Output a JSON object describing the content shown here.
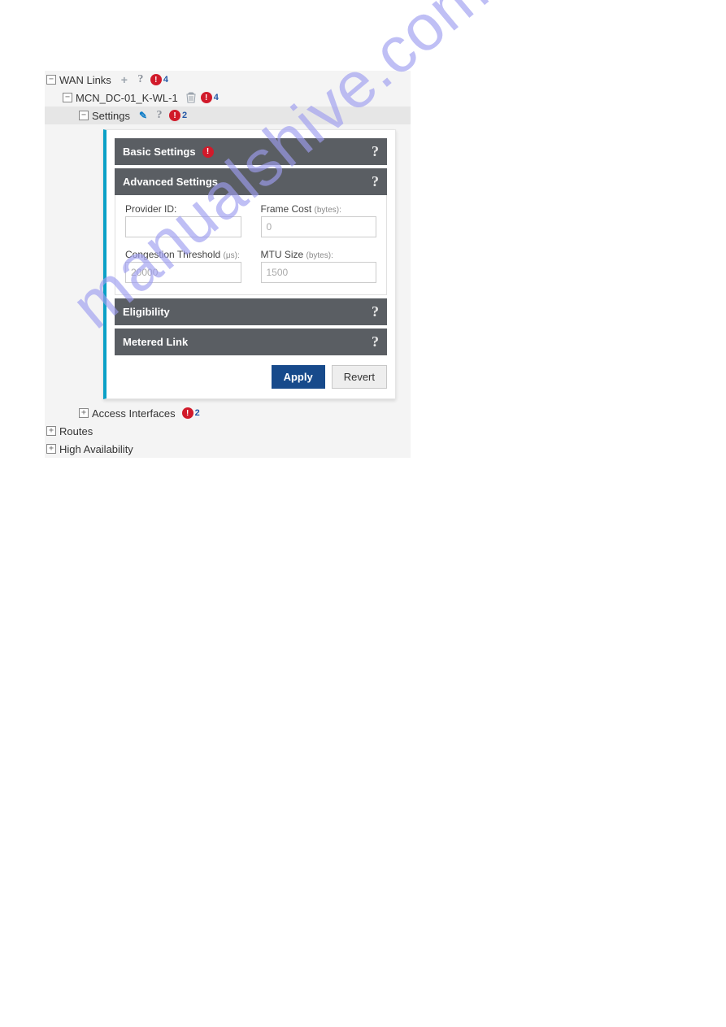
{
  "watermark": "manualshive.com",
  "tree": {
    "wan_links": {
      "label": "WAN Links",
      "alert_count": "4"
    },
    "mcn": {
      "label": "MCN_DC-01_K-WL-1",
      "alert_count": "4"
    },
    "settings": {
      "label": "Settings",
      "alert_count": "2"
    },
    "access_if": {
      "label": "Access Interfaces",
      "alert_count": "2"
    },
    "routes": {
      "label": "Routes"
    },
    "ha": {
      "label": "High Availability"
    }
  },
  "panel": {
    "sections": {
      "basic": "Basic Settings",
      "advanced": "Advanced Settings",
      "elig": "Eligibility",
      "metered": "Metered Link"
    },
    "fields": {
      "provider_id": {
        "label": "Provider ID:",
        "value": ""
      },
      "frame_cost": {
        "label_main": "Frame Cost",
        "label_unit": "(bytes):",
        "placeholder": "0"
      },
      "cong_thresh": {
        "label_main": "Congestion Threshold",
        "label_unit": "(μs):",
        "placeholder": "20000"
      },
      "mtu_size": {
        "label_main": "MTU Size",
        "label_unit": "(bytes):",
        "placeholder": "1500"
      }
    },
    "buttons": {
      "apply": "Apply",
      "revert": "Revert"
    }
  },
  "glyphs": {
    "plus_box_minus": "−",
    "plus_box_plus": "+",
    "help": "?",
    "alert": "!"
  }
}
